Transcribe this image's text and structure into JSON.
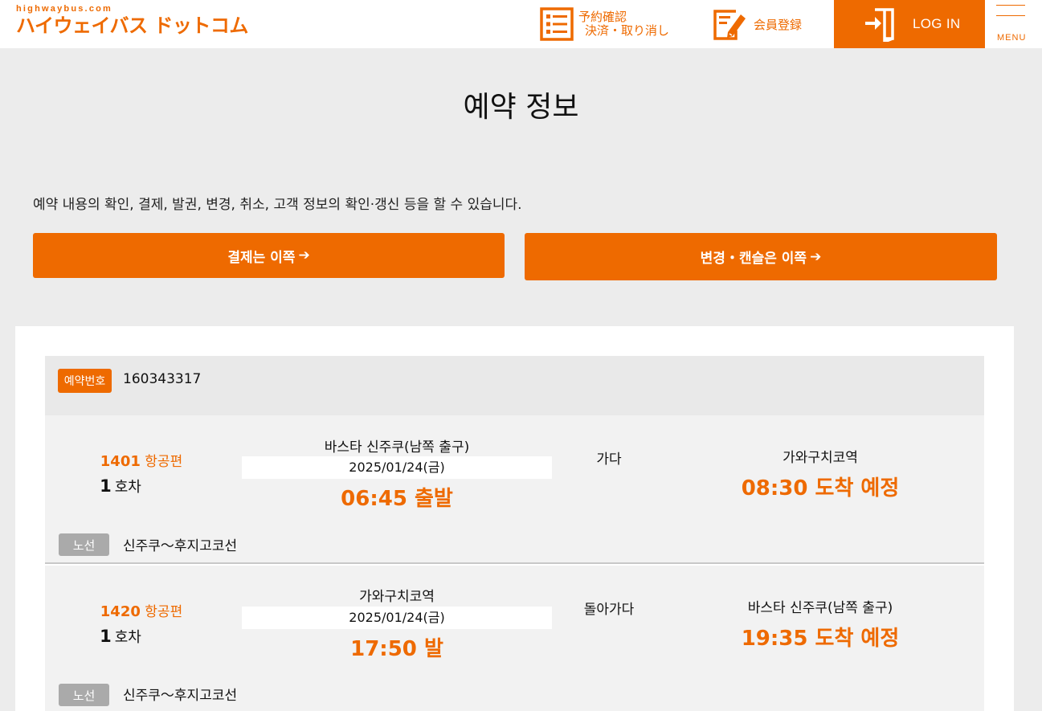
{
  "header": {
    "logo_small": "highwaybus.com",
    "logo_main": "ハイウェイバス ドットコム",
    "reservation_link": {
      "line1": "予約確認",
      "line2": "決済・取り消し",
      "icon": "list-icon"
    },
    "register_link": {
      "label": "会員登録",
      "icon": "edit-icon"
    },
    "login": {
      "label": "LOG IN",
      "icon": "login-icon"
    },
    "menu": {
      "label": "MENU",
      "icon": "hamburger-icon"
    }
  },
  "main": {
    "title": "예약 정보",
    "description": "예약 내용의 확인, 결제, 발권, 변경, 취소, 고객 정보의 확인·갱신 등을 할 수 있습니다.",
    "pay_button": "결제는 이쪽",
    "change_button": "변경・캔슬은 이쪽",
    "arrow": "➔"
  },
  "reservation": {
    "number_label": "예약번호",
    "number": "160343317",
    "trips": [
      {
        "flight_no": "1401",
        "flight_suffix": "항공편",
        "car_no": "1",
        "car_suffix": "호차",
        "departure_stop": "바스타 신주쿠(남쪽 출구)",
        "date": "2025/01/24(금)",
        "departure_time": "06:45 출발",
        "direction": "가다",
        "arrival_stop": "가와구치코역",
        "arrival_time": "08:30 도착 예정",
        "route_label": "노선",
        "route_name": "신주쿠～후지고코선"
      },
      {
        "flight_no": "1420",
        "flight_suffix": "항공편",
        "car_no": "1",
        "car_suffix": "호차",
        "departure_stop": "가와구치코역",
        "date": "2025/01/24(금)",
        "departure_time": "17:50 발",
        "direction": "돌아가다",
        "arrival_stop": "바스타 신주쿠(남쪽 출구)",
        "arrival_time": "19:35 도착 예정",
        "route_label": "노선",
        "route_name": "신주쿠～후지고코선"
      }
    ]
  },
  "colors": {
    "accent": "#ee6a00",
    "background": "#ececec",
    "muted_badge": "#aaaaaa"
  }
}
